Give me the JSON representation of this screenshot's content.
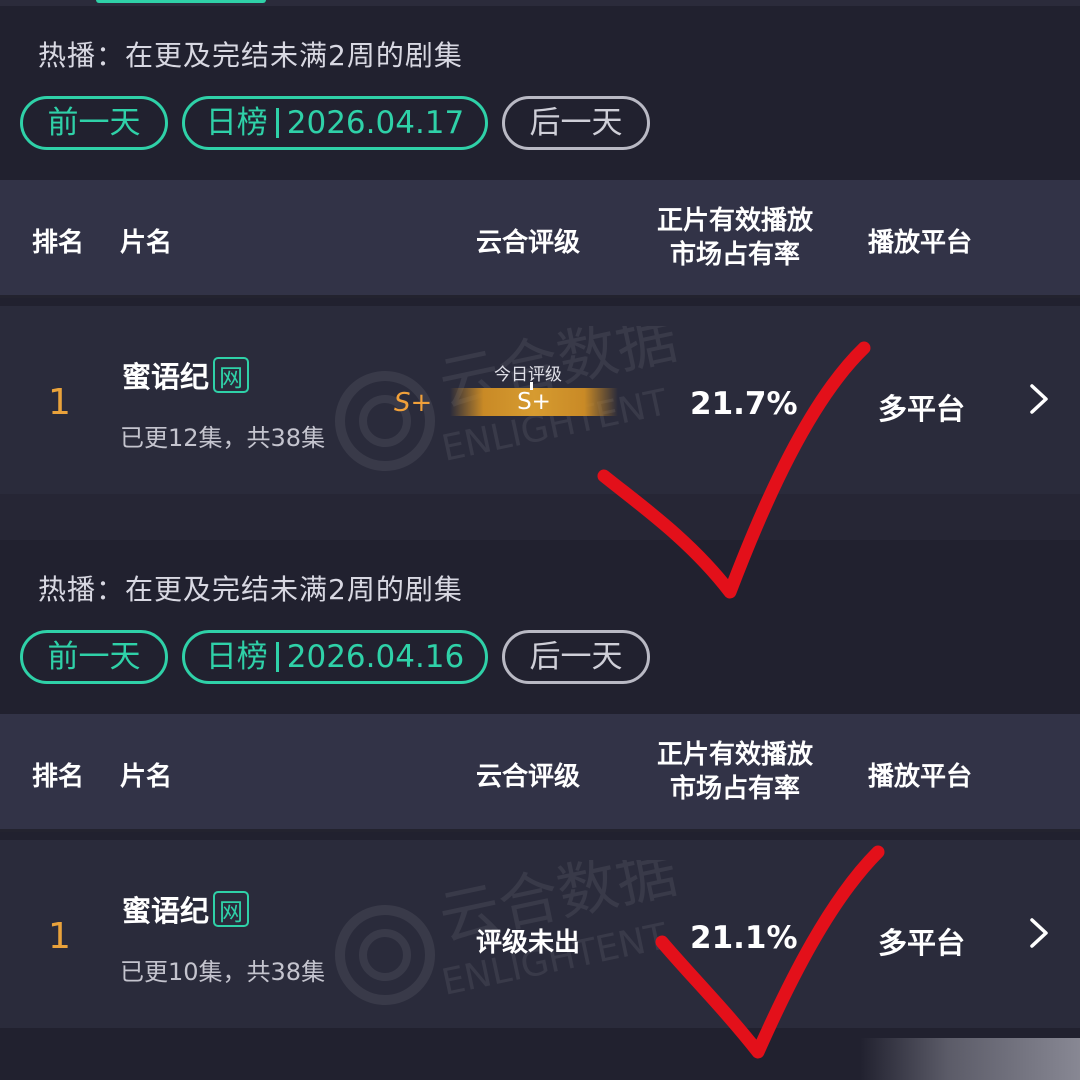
{
  "sections": [
    {
      "title": "热播：在更及完结未满2周的剧集",
      "prev_label": "前一天",
      "board_label": "日榜",
      "date": "2026.04.17",
      "next_label": "后一天",
      "headers": {
        "rank": "排名",
        "name": "片名",
        "grade": "云合评级",
        "share_line1": "正片有效播放",
        "share_line2": "市场占有率",
        "platform": "播放平台"
      },
      "row": {
        "rank": "1",
        "title": "蜜语纪",
        "badge": "网",
        "episodes": "已更12集，共38集",
        "grade": "S+",
        "today_grade_label": "今日评级",
        "today_grade": "S+",
        "share": "21.7%",
        "platform": "多平台"
      }
    },
    {
      "title": "热播：在更及完结未满2周的剧集",
      "prev_label": "前一天",
      "board_label": "日榜",
      "date": "2026.04.16",
      "next_label": "后一天",
      "headers": {
        "rank": "排名",
        "name": "片名",
        "grade": "云合评级",
        "share_line1": "正片有效播放",
        "share_line2": "市场占有率",
        "platform": "播放平台"
      },
      "row": {
        "rank": "1",
        "title": "蜜语纪",
        "badge": "网",
        "episodes": "已更10集，共38集",
        "grade_status": "评级未出",
        "share": "21.1%",
        "platform": "多平台"
      }
    }
  ],
  "watermark": {
    "cn": "云合数据",
    "en": "ENLIGHTENT"
  },
  "colors": {
    "accent": "#2fd1a8",
    "rank": "#e9a23b",
    "grade": "#d69b30",
    "check": "#e3101a",
    "bg": "#21212f"
  },
  "icons": {
    "chevron": "chevron-right-icon",
    "checkmark": "red-checkmark-annotation"
  }
}
